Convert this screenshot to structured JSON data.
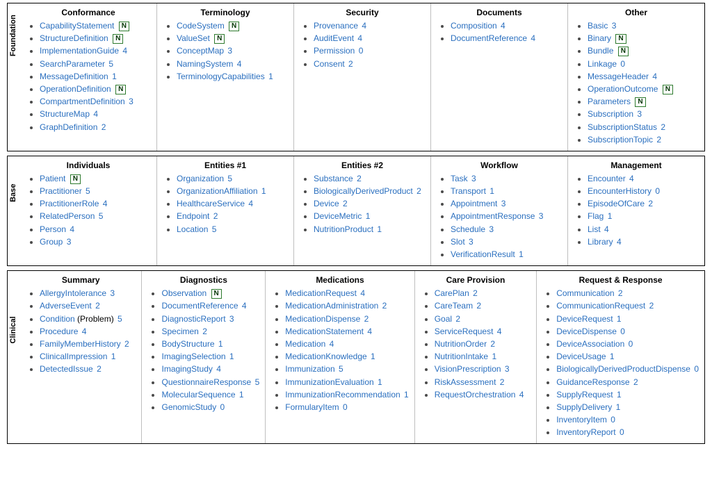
{
  "normative_label": "N",
  "sections": [
    {
      "label": "Foundation",
      "columns": [
        {
          "title": "Conformance",
          "items": [
            {
              "name": "CapabilityStatement",
              "normative": true
            },
            {
              "name": "StructureDefinition",
              "normative": true
            },
            {
              "name": "ImplementationGuide",
              "maturity": 4
            },
            {
              "name": "SearchParameter",
              "maturity": 5
            },
            {
              "name": "MessageDefinition",
              "maturity": 1
            },
            {
              "name": "OperationDefinition",
              "normative": true
            },
            {
              "name": "CompartmentDefinition",
              "maturity": 3
            },
            {
              "name": "StructureMap",
              "maturity": 4
            },
            {
              "name": "GraphDefinition",
              "maturity": 2
            }
          ]
        },
        {
          "title": "Terminology",
          "items": [
            {
              "name": "CodeSystem",
              "normative": true
            },
            {
              "name": "ValueSet",
              "normative": true
            },
            {
              "name": "ConceptMap",
              "maturity": 3
            },
            {
              "name": "NamingSystem",
              "maturity": 4
            },
            {
              "name": "TerminologyCapabilities",
              "maturity": 1
            }
          ]
        },
        {
          "title": "Security",
          "items": [
            {
              "name": "Provenance",
              "maturity": 4
            },
            {
              "name": "AuditEvent",
              "maturity": 4
            },
            {
              "name": "Permission",
              "maturity": 0
            },
            {
              "name": "Consent",
              "maturity": 2
            }
          ]
        },
        {
          "title": "Documents",
          "items": [
            {
              "name": "Composition",
              "maturity": 4
            },
            {
              "name": "DocumentReference",
              "maturity": 4
            }
          ]
        },
        {
          "title": "Other",
          "items": [
            {
              "name": "Basic",
              "maturity": 3
            },
            {
              "name": "Binary",
              "normative": true
            },
            {
              "name": "Bundle",
              "normative": true
            },
            {
              "name": "Linkage",
              "maturity": 0
            },
            {
              "name": "MessageHeader",
              "maturity": 4
            },
            {
              "name": "OperationOutcome",
              "normative": true
            },
            {
              "name": "Parameters",
              "normative": true
            },
            {
              "name": "Subscription",
              "maturity": 3
            },
            {
              "name": "SubscriptionStatus",
              "maturity": 2
            },
            {
              "name": "SubscriptionTopic",
              "maturity": 2
            }
          ]
        }
      ]
    },
    {
      "label": "Base",
      "columns": [
        {
          "title": "Individuals",
          "items": [
            {
              "name": "Patient",
              "normative": true
            },
            {
              "name": "Practitioner",
              "maturity": 5
            },
            {
              "name": "PractitionerRole",
              "maturity": 4
            },
            {
              "name": "RelatedPerson",
              "maturity": 5
            },
            {
              "name": "Person",
              "maturity": 4
            },
            {
              "name": "Group",
              "maturity": 3
            }
          ]
        },
        {
          "title": "Entities #1",
          "items": [
            {
              "name": "Organization",
              "maturity": 5
            },
            {
              "name": "OrganizationAffiliation",
              "maturity": 1
            },
            {
              "name": "HealthcareService",
              "maturity": 4
            },
            {
              "name": "Endpoint",
              "maturity": 2
            },
            {
              "name": "Location",
              "maturity": 5
            }
          ]
        },
        {
          "title": "Entities #2",
          "items": [
            {
              "name": "Substance",
              "maturity": 2
            },
            {
              "name": "BiologicallyDerivedProduct",
              "maturity": 2
            },
            {
              "name": "Device",
              "maturity": 2
            },
            {
              "name": "DeviceMetric",
              "maturity": 1
            },
            {
              "name": "NutritionProduct",
              "maturity": 1
            }
          ]
        },
        {
          "title": "Workflow",
          "items": [
            {
              "name": "Task",
              "maturity": 3
            },
            {
              "name": "Transport",
              "maturity": 1
            },
            {
              "name": "Appointment",
              "maturity": 3
            },
            {
              "name": "AppointmentResponse",
              "maturity": 3
            },
            {
              "name": "Schedule",
              "maturity": 3
            },
            {
              "name": "Slot",
              "maturity": 3
            },
            {
              "name": "VerificationResult",
              "maturity": 1
            }
          ]
        },
        {
          "title": "Management",
          "items": [
            {
              "name": "Encounter",
              "maturity": 4
            },
            {
              "name": "EncounterHistory",
              "maturity": 0
            },
            {
              "name": "EpisodeOfCare",
              "maturity": 2
            },
            {
              "name": "Flag",
              "maturity": 1
            },
            {
              "name": "List",
              "maturity": 4
            },
            {
              "name": "Library",
              "maturity": 4
            }
          ]
        }
      ]
    },
    {
      "label": "Clinical",
      "columns": [
        {
          "title": "Summary",
          "items": [
            {
              "name": "AllergyIntolerance",
              "maturity": 3
            },
            {
              "name": "AdverseEvent",
              "maturity": 2
            },
            {
              "name": "Condition",
              "paren": "Problem",
              "maturity": 5
            },
            {
              "name": "Procedure",
              "maturity": 4
            },
            {
              "name": "FamilyMemberHistory",
              "maturity": 2
            },
            {
              "name": "ClinicalImpression",
              "maturity": 1
            },
            {
              "name": "DetectedIssue",
              "maturity": 2
            }
          ]
        },
        {
          "title": "Diagnostics",
          "items": [
            {
              "name": "Observation",
              "normative": true
            },
            {
              "name": "DocumentReference",
              "maturity": 4
            },
            {
              "name": "DiagnosticReport",
              "maturity": 3
            },
            {
              "name": "Specimen",
              "maturity": 2
            },
            {
              "name": "BodyStructure",
              "maturity": 1
            },
            {
              "name": "ImagingSelection",
              "maturity": 1
            },
            {
              "name": "ImagingStudy",
              "maturity": 4
            },
            {
              "name": "QuestionnaireResponse",
              "maturity": 5
            },
            {
              "name": "MolecularSequence",
              "maturity": 1
            },
            {
              "name": "GenomicStudy",
              "maturity": 0
            }
          ]
        },
        {
          "title": "Medications",
          "items": [
            {
              "name": "MedicationRequest",
              "maturity": 4
            },
            {
              "name": "MedicationAdministration",
              "maturity": 2
            },
            {
              "name": "MedicationDispense",
              "maturity": 2
            },
            {
              "name": "MedicationStatement",
              "maturity": 4
            },
            {
              "name": "Medication",
              "maturity": 4
            },
            {
              "name": "MedicationKnowledge",
              "maturity": 1
            },
            {
              "name": "Immunization",
              "maturity": 5
            },
            {
              "name": "ImmunizationEvaluation",
              "maturity": 1
            },
            {
              "name": "ImmunizationRecommendation",
              "maturity": 1
            },
            {
              "name": "FormularyItem",
              "maturity": 0
            }
          ]
        },
        {
          "title": "Care Provision",
          "items": [
            {
              "name": "CarePlan",
              "maturity": 2
            },
            {
              "name": "CareTeam",
              "maturity": 2
            },
            {
              "name": "Goal",
              "maturity": 2
            },
            {
              "name": "ServiceRequest",
              "maturity": 4
            },
            {
              "name": "NutritionOrder",
              "maturity": 2
            },
            {
              "name": "NutritionIntake",
              "maturity": 1
            },
            {
              "name": "VisionPrescription",
              "maturity": 3
            },
            {
              "name": "RiskAssessment",
              "maturity": 2
            },
            {
              "name": "RequestOrchestration",
              "maturity": 4
            }
          ]
        },
        {
          "title": "Request & Response",
          "items": [
            {
              "name": "Communication",
              "maturity": 2
            },
            {
              "name": "CommunicationRequest",
              "maturity": 2
            },
            {
              "name": "DeviceRequest",
              "maturity": 1
            },
            {
              "name": "DeviceDispense",
              "maturity": 0
            },
            {
              "name": "DeviceAssociation",
              "maturity": 0
            },
            {
              "name": "DeviceUsage",
              "maturity": 1
            },
            {
              "name": "BiologicallyDerivedProductDispense",
              "maturity": 0
            },
            {
              "name": "GuidanceResponse",
              "maturity": 2
            },
            {
              "name": "SupplyRequest",
              "maturity": 1
            },
            {
              "name": "SupplyDelivery",
              "maturity": 1
            },
            {
              "name": "InventoryItem",
              "maturity": 0
            },
            {
              "name": "InventoryReport",
              "maturity": 0
            }
          ]
        }
      ]
    }
  ]
}
